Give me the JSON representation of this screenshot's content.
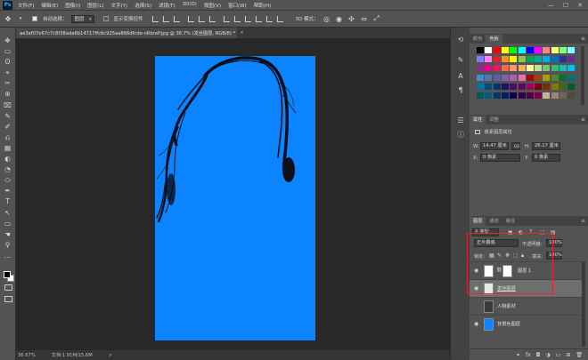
{
  "menubar": {
    "logo": "Ps",
    "items": [
      "文件(F)",
      "编辑(E)",
      "图像(I)",
      "图层(L)",
      "文字(Y)",
      "选择(S)",
      "滤镜(T)",
      "3D(D)",
      "视图(V)",
      "窗口(W)",
      "帮助(H)"
    ],
    "win_controls": [
      "—",
      "☐",
      "✕"
    ]
  },
  "options_bar": {
    "auto_select_label": "自动选择：",
    "auto_select_value": "图层",
    "show_transform_label": "显示变换控件",
    "mode_3d_label": "3D 模式："
  },
  "document": {
    "tab_title": "ae3ef07e67c7c8f38ada6b14717ffc6c925aa866dfcde-nRbreP.jpg @ 36.7% (发丝图层, RGB/8) *",
    "tab_close": "×",
    "canvas_color": "#0c84ff"
  },
  "status": {
    "zoom": "36.67%",
    "doc_info": "文档:1.91M/15.6M",
    "arrow": ">"
  },
  "swatches_panel": {
    "tabs": [
      "颜色",
      "色板"
    ],
    "active_tab": 1,
    "rows": [
      [
        "#000000",
        "#ffffff",
        "#ff0000",
        "#ffff00",
        "#00ff00",
        "#00ffff",
        "#0000ff",
        "#ff00ff",
        "#ff8080",
        "#ffff80",
        "#80ff80",
        "#80ffff"
      ],
      [
        "#8080ff",
        "#ff80ff",
        "#ed1c24",
        "#f7941d",
        "#fff200",
        "#8dc63f",
        "#00a651",
        "#00a99d",
        "#00aeef",
        "#0072bc",
        "#2e3192",
        "#662d91"
      ],
      [
        "#92278f",
        "#ec008c",
        "#ed145b",
        "#f26c4f",
        "#f69679",
        "#fbaf5d",
        "#fff799",
        "#c4df9b",
        "#7cc576",
        "#3bb878",
        "#1abbb4",
        "#00bff3"
      ],
      [
        "#448ccb",
        "#5674b9",
        "#605ca8",
        "#855fa8",
        "#a763a8",
        "#f06eaa",
        "#9e0b0f",
        "#a0410d",
        "#aba000",
        "#598527",
        "#007236",
        "#00746b"
      ],
      [
        "#0076a3",
        "#004a80",
        "#003471",
        "#1b1464",
        "#440e62",
        "#630460",
        "#9e005d",
        "#790000",
        "#7b2e00",
        "#827b00",
        "#406618",
        "#005e20"
      ],
      [
        "#005952",
        "#005b7f",
        "#003663",
        "#002157",
        "#0d004c",
        "#32004b",
        "#4b0049",
        "#7b0046",
        "#c7b299",
        "#998675",
        "#736357",
        "#534741"
      ]
    ]
  },
  "properties_panel": {
    "tabs": [
      "属性",
      "调整"
    ],
    "active_tab": 0,
    "title": "像素图层属性",
    "w_label": "W:",
    "w_value": "14.47 厘米",
    "link": "GO",
    "h_label": "H:",
    "h_value": "26.17 厘米",
    "x_label": "X:",
    "x_value": "0 像素",
    "y_label": "Y:",
    "y_value": "0 像素"
  },
  "layers_panel": {
    "tabs": [
      "图层",
      "通道",
      "路径"
    ],
    "active_tab": 0,
    "filter_label": "类型",
    "blend_mode": "正片叠底",
    "opacity_label": "不透明度:",
    "opacity_value": "100%",
    "lock_label": "锁定:",
    "fill_label": "填充:",
    "fill_value": "100%",
    "layers": [
      {
        "name": "图层 1",
        "visible": true,
        "selected": false,
        "thumb": "#ffffff",
        "has_mask": true
      },
      {
        "name": "发丝图层",
        "visible": true,
        "selected": true,
        "thumb": "#e8e8e8",
        "has_mask": false
      },
      {
        "name": "人物素材",
        "visible": false,
        "selected": false,
        "thumb": "#3a3a3a",
        "has_mask": false
      },
      {
        "name": "背景色图层",
        "visible": true,
        "selected": false,
        "thumb": "#0c84ff",
        "has_mask": false
      }
    ],
    "footer_icons": [
      "link-icon",
      "fx-icon",
      "mask-icon",
      "adjustment-icon",
      "folder-icon",
      "new-layer-icon",
      "trash-icon"
    ],
    "footer_glyphs": [
      "⚭",
      "fx",
      "◘",
      "◑",
      "▭",
      "⊞",
      "🗑"
    ]
  },
  "highlight_color": "#e0282c",
  "tools": [
    "✥",
    "▭",
    "ʘ",
    "⌖",
    "✂",
    "⊕",
    "⌧",
    "✎",
    "✐",
    "⎌",
    "▦",
    "◐",
    "◔",
    "⬭",
    "✒",
    "T",
    "↖",
    "▭",
    "☚",
    "⚲",
    "…"
  ]
}
